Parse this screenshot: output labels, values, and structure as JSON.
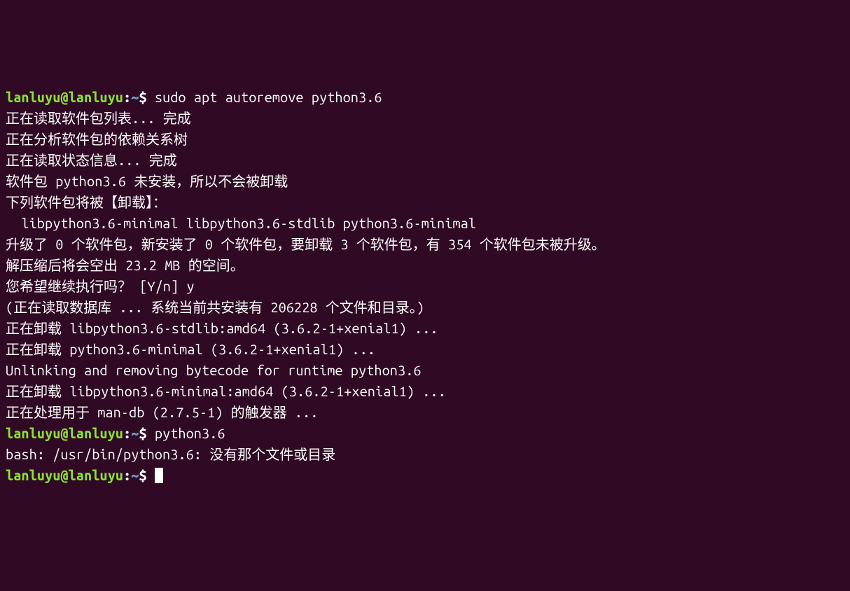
{
  "prompt": {
    "user_host": "lanluyu@lanluyu",
    "colon": ":",
    "path": "~",
    "dollar": "$ "
  },
  "commands": {
    "cmd1": "sudo apt autoremove python3.6",
    "cmd2": "python3.6"
  },
  "output": {
    "l1": "正在读取软件包列表... 完成",
    "l2": "正在分析软件包的依赖关系树",
    "l3": "正在读取状态信息... 完成",
    "l4": "软件包 python3.6 未安装，所以不会被卸载",
    "l5": "下列软件包将被【卸载】：",
    "l6": "  libpython3.6-minimal libpython3.6-stdlib python3.6-minimal",
    "l7": "升级了 0 个软件包，新安装了 0 个软件包，要卸载 3 个软件包，有 354 个软件包未被升级。",
    "l8": "解压缩后将会空出 23.2 MB 的空间。",
    "l9": "您希望继续执行吗？ [Y/n] y",
    "l10": "(正在读取数据库 ... 系统当前共安装有 206228 个文件和目录。)",
    "l11": "正在卸载 libpython3.6-stdlib:amd64 (3.6.2-1+xenial1) ...",
    "l12": "正在卸载 python3.6-minimal (3.6.2-1+xenial1) ...",
    "l13": "Unlinking and removing bytecode for runtime python3.6",
    "l14": "正在卸载 libpython3.6-minimal:amd64 (3.6.2-1+xenial1) ...",
    "l15": "正在处理用于 man-db (2.7.5-1) 的触发器 ...",
    "l16": "bash: /usr/bin/python3.6: 没有那个文件或目录"
  }
}
